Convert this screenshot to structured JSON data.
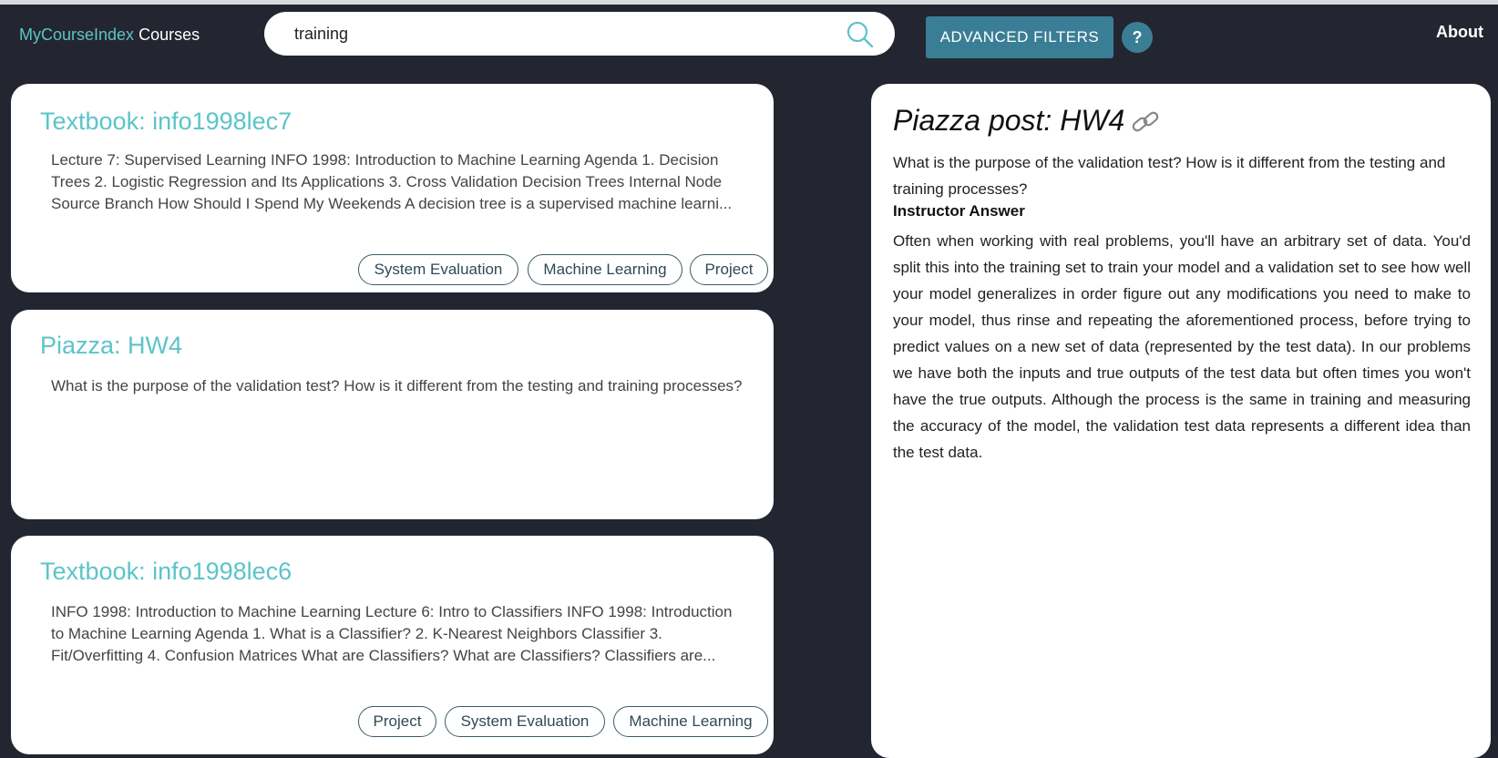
{
  "header": {
    "brand_accent": "MyCourseIndex",
    "brand_rest": " Courses",
    "search_value": "training",
    "advanced_filters_label": "ADVANCED FILTERS",
    "help_label": "?",
    "about_label": "About"
  },
  "results": [
    {
      "title": "Textbook: info1998lec7",
      "snippet": "Lecture 7: Supervised Learning INFO 1998: Introduction to Machine Learning Agenda 1. Decision Trees 2. Logistic Regression and Its Applications 3. Cross Validation Decision Trees Internal Node Source Branch How Should I Spend My Weekends A decision tree is a supervised machine learni...",
      "tags": [
        "System Evaluation",
        "Machine Learning",
        "Project"
      ]
    },
    {
      "title": "Piazza: HW4",
      "snippet": "What is the purpose of the validation test? How is it different from the testing and training processes?",
      "tags": []
    },
    {
      "title": "Textbook: info1998lec6",
      "snippet": "INFO 1998: Introduction to Machine Learning Lecture 6: Intro to Classifiers INFO 1998: Introduction to Machine Learning Agenda 1. What is a Classifier? 2. K-Nearest Neighbors Classifier 3. Fit/Overfitting 4. Confusion Matrices What are Classifiers? What are Classifiers? Classifiers are...",
      "tags": [
        "Project",
        "System Evaluation",
        "Machine Learning"
      ]
    }
  ],
  "detail": {
    "title": "Piazza post: HW4",
    "question": "What is the purpose of the validation test? How is it different from the testing and training processes?",
    "answer_label": "Instructor Answer",
    "answer": "Often when working with real problems, you'll have an arbitrary set of data. You'd split this into the training set to train your model and a validation set to see how well your model generalizes in order figure out any modifications you need to make to your model, thus rinse and repeating the aforementioned process, before trying to predict values on a new set of data (represented by the test data). In our problems we have both the inputs and true outputs of the test data but often times you won't have the true outputs. Although the process is the same in training and measuring the accuracy of the model, the validation test data represents a different idea than the test data."
  },
  "colors": {
    "background": "#232630",
    "accent": "#5cc4c9",
    "button": "#3a7e96"
  },
  "icons": {
    "search": "search-icon",
    "link": "link-icon"
  }
}
